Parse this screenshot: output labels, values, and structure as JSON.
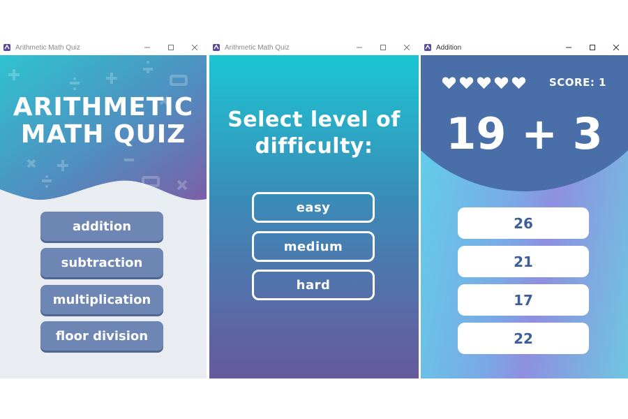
{
  "windows": {
    "menu": {
      "title": "Arithmetic Math Quiz",
      "hero_line1": "ARITHMETIC",
      "hero_line2": "MATH QUIZ",
      "buttons": [
        "addition",
        "subtraction",
        "multiplication",
        "floor division"
      ],
      "button_color": "#6d86b4"
    },
    "difficulty": {
      "title": "Arithmetic Math Quiz",
      "heading_line1": "Select level of",
      "heading_line2": "difficulty:",
      "levels": [
        "easy",
        "medium",
        "hard"
      ]
    },
    "game": {
      "title": "Addition",
      "lives": 5,
      "score_label": "SCORE: 1",
      "question": "19 + 3",
      "answers": [
        "26",
        "21",
        "17",
        "22"
      ],
      "accent_color": "#4a6fa8"
    }
  },
  "icons": {
    "minimize": "minimize-icon",
    "maximize": "maximize-icon",
    "close": "close-icon",
    "heart": "heart-icon"
  }
}
